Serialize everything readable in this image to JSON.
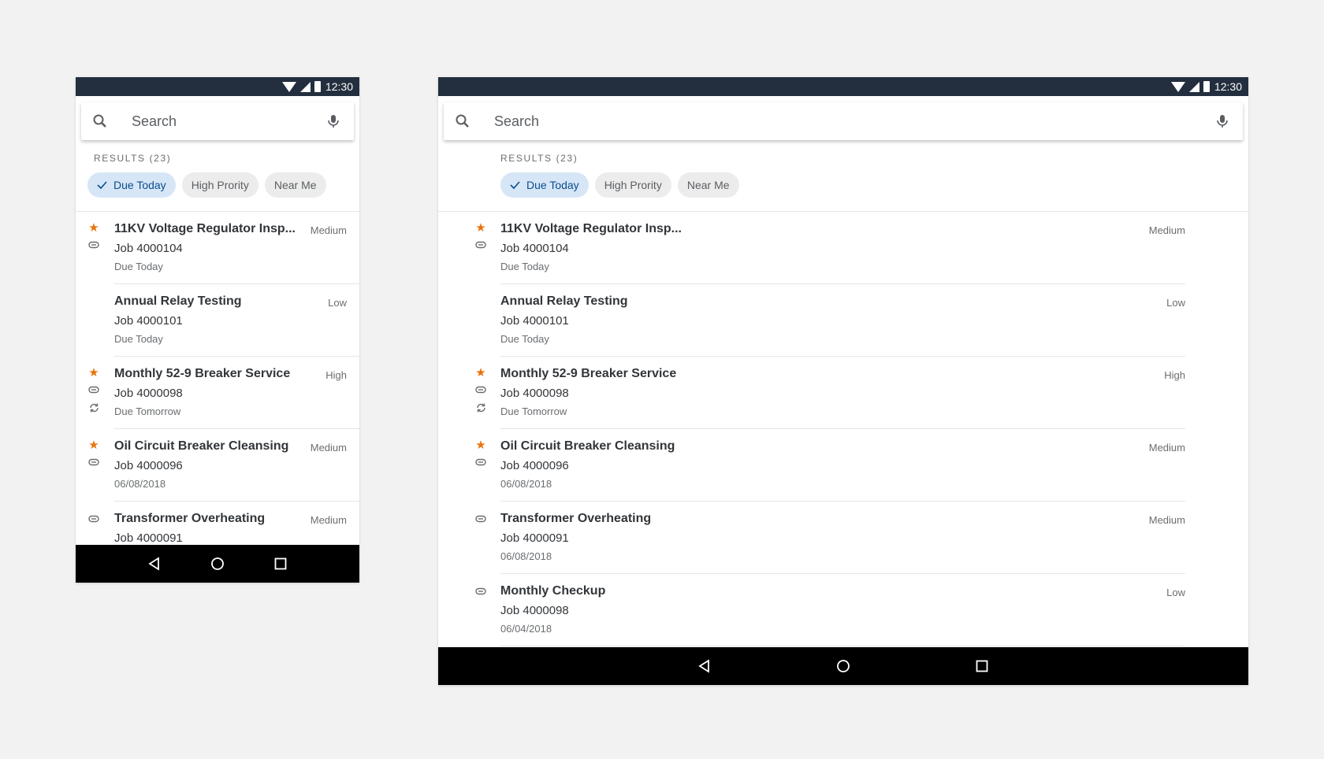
{
  "status": {
    "time": "12:30"
  },
  "search": {
    "placeholder": "Search"
  },
  "results_label": "RESULTS (23)",
  "chips": [
    {
      "label": "Due Today",
      "selected": true
    },
    {
      "label": "High Prority",
      "selected": false
    },
    {
      "label": "Near Me",
      "selected": false
    }
  ],
  "phone_items": [
    {
      "title": "11KV Voltage Regulator Insp...",
      "job": "Job 4000104",
      "due": "Due Today",
      "priority": "Medium",
      "icons": [
        "star-icon",
        "attachment-icon"
      ]
    },
    {
      "title": "Annual Relay Testing",
      "job": "Job 4000101",
      "due": "Due Today",
      "priority": "Low",
      "icons": []
    },
    {
      "title": "Monthly 52-9 Breaker Service",
      "job": "Job 4000098",
      "due": "Due Tomorrow",
      "priority": "High",
      "icons": [
        "star-icon",
        "attachment-icon",
        "sync-icon"
      ]
    },
    {
      "title": "Oil Circuit Breaker Cleansing",
      "job": "Job 4000096",
      "due": "06/08/2018",
      "priority": "Medium",
      "icons": [
        "star-icon",
        "attachment-icon"
      ]
    },
    {
      "title": "Transformer Overheating",
      "job": "Job 4000091",
      "due": "",
      "priority": "Medium",
      "icons": [
        "attachment-icon"
      ]
    }
  ],
  "tablet_items": [
    {
      "title": "11KV Voltage Regulator Insp...",
      "job": "Job 4000104",
      "due": "Due Today",
      "priority": "Medium",
      "icons": [
        "star-icon",
        "attachment-icon"
      ]
    },
    {
      "title": "Annual Relay Testing",
      "job": "Job 4000101",
      "due": "Due Today",
      "priority": "Low",
      "icons": []
    },
    {
      "title": "Monthly 52-9 Breaker Service",
      "job": "Job 4000098",
      "due": "Due Tomorrow",
      "priority": "High",
      "icons": [
        "star-icon",
        "attachment-icon",
        "sync-icon"
      ]
    },
    {
      "title": "Oil Circuit Breaker Cleansing",
      "job": "Job 4000096",
      "due": "06/08/2018",
      "priority": "Medium",
      "icons": [
        "star-icon",
        "attachment-icon"
      ]
    },
    {
      "title": "Transformer Overheating",
      "job": "Job 4000091",
      "due": "06/08/2018",
      "priority": "Medium",
      "icons": [
        "attachment-icon"
      ]
    },
    {
      "title": "Monthly Checkup",
      "job": "Job 4000098",
      "due": "06/04/2018",
      "priority": "Low",
      "icons": [
        "attachment-icon"
      ]
    }
  ],
  "colors": {
    "statusbar": "#232f3e",
    "accent": "#0a6ed1",
    "star": "#e9730c",
    "chip_selected_bg": "#d6e6f7"
  }
}
